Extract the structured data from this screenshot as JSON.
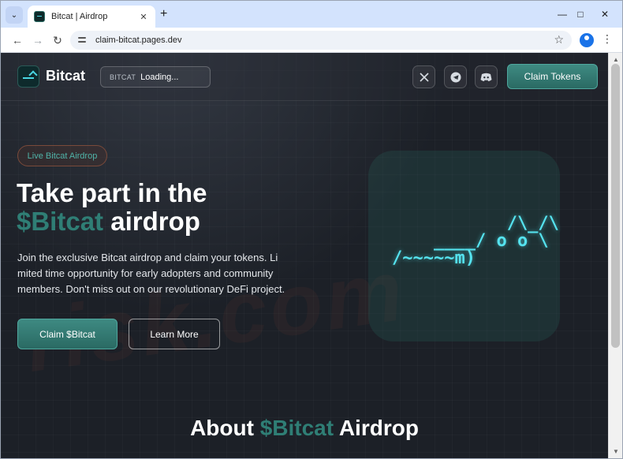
{
  "browser": {
    "tab_title": "Bitcat | Airdrop",
    "url": "claim-bitcat.pages.dev"
  },
  "header": {
    "logo_text": "Bitcat",
    "price_ticker": "BITCAT",
    "price_value": "Loading...",
    "claim_tokens_label": "Claim Tokens",
    "social": [
      "x-icon",
      "telegram-icon",
      "discord-icon"
    ]
  },
  "hero": {
    "badge": "Live Bitcat Airdrop",
    "title_line1": "Take part in the",
    "title_accent": "$Bitcat",
    "title_line2_rest": " airdrop",
    "description": " Join the exclusive Bitcat airdrop and claim your tokens. Li mited time opportunity for early adopters and community members. Don't miss out on our revolutionary DeFi project.",
    "primary_button": "Claim $Bitcat",
    "secondary_button": "Learn More",
    "ascii_art": "           /\\_/\\\n    ____/ o o \\\n/~~~~~m)"
  },
  "about": {
    "prefix": "About ",
    "accent": "$Bitcat",
    "suffix": " Airdrop"
  },
  "colors": {
    "accent": "#2f7e75",
    "button": "#3e8a82",
    "ascii": "#55e3ef",
    "background": "#1c2027"
  }
}
